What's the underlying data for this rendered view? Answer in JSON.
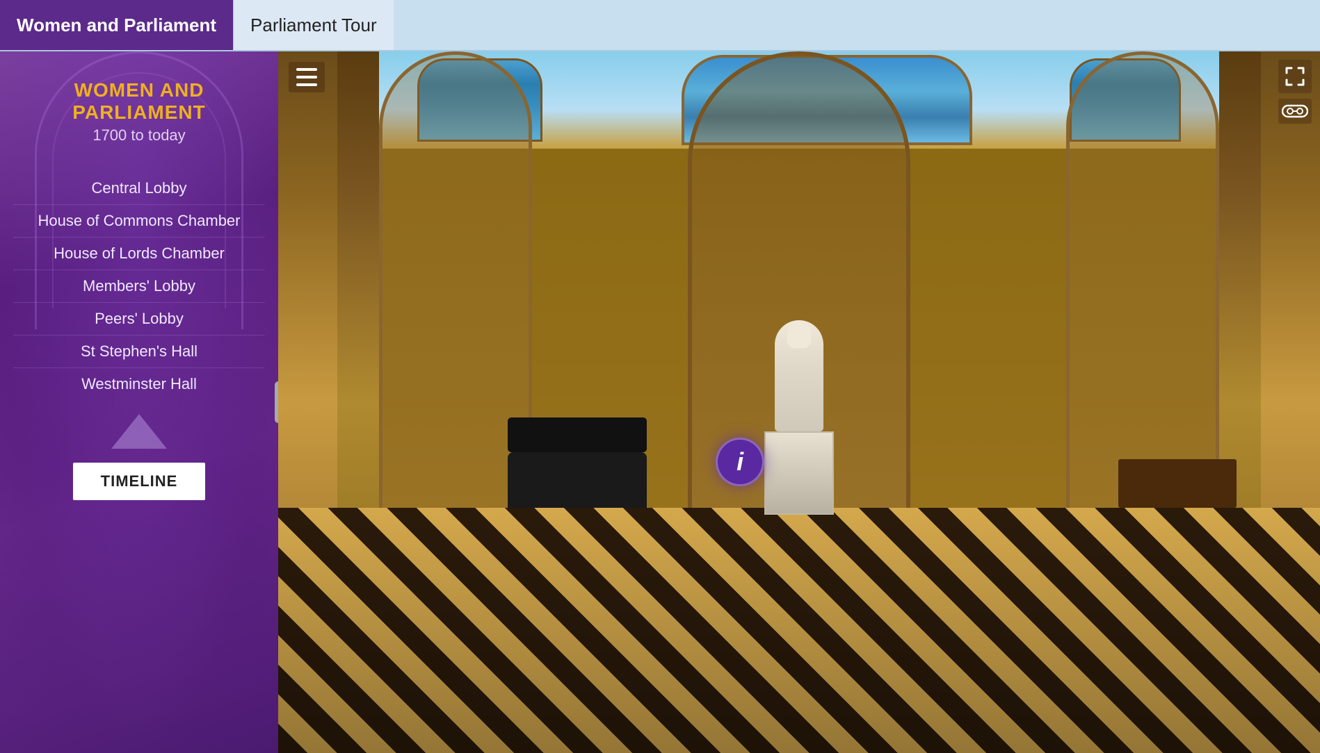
{
  "nav": {
    "tab_women_label": "Women and Parliament",
    "tab_parliament_label": "Parliament Tour"
  },
  "sidebar": {
    "title_main": "WOMEN AND PARLIAMENT",
    "title_sub": "1700 to today",
    "nav_items": [
      {
        "id": "central-lobby",
        "label": "Central Lobby"
      },
      {
        "id": "commons-chamber",
        "label": "House of Commons Chamber"
      },
      {
        "id": "lords-chamber",
        "label": "House of Lords Chamber"
      },
      {
        "id": "members-lobby",
        "label": "Members' Lobby"
      },
      {
        "id": "peers-lobby",
        "label": "Peers' Lobby"
      },
      {
        "id": "st-stephens-hall",
        "label": "St Stephen's Hall"
      },
      {
        "id": "westminster-hall",
        "label": "Westminster Hall"
      }
    ],
    "timeline_label": "TIMELINE"
  },
  "pano": {
    "info_button_label": "i",
    "current_location": "Central Lobby"
  },
  "colors": {
    "nav_tab_women_bg": "#5b2a8a",
    "nav_tab_parliament_bg": "#dde8f5",
    "sidebar_bg_start": "#7b3fa0",
    "sidebar_bg_end": "#4a1a70",
    "sidebar_title_color": "#f0b020",
    "info_btn_bg": "#5a28a0",
    "timeline_btn_bg": "#ffffff"
  }
}
